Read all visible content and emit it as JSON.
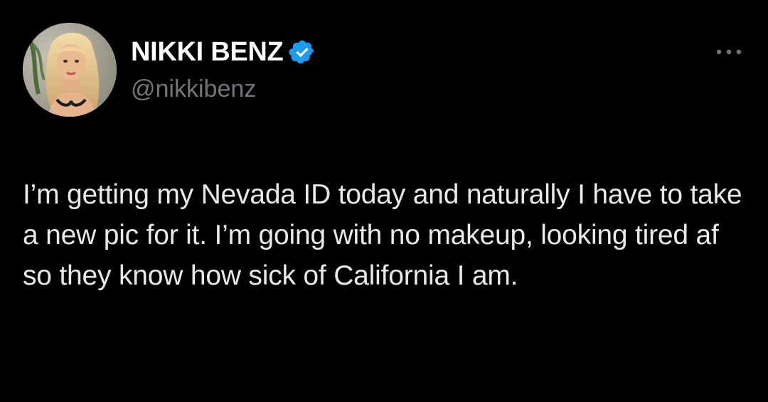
{
  "tweet": {
    "author": {
      "display_name": "NIKKI BENZ",
      "handle": "@nikkibenz",
      "verified": true,
      "verified_badge_color": "#1d9bf0",
      "avatar_icon": "profile-photo"
    },
    "more_icon": "more-horizontal-icon",
    "text": "I’m getting my Nevada ID today and naturally I have to take a new pic for it. I’m going with no makeup, looking tired af so they know how sick of California I am."
  },
  "theme": {
    "background": "#000000",
    "text_color": "#e7e9ea",
    "secondary_text_color": "#71767b"
  }
}
